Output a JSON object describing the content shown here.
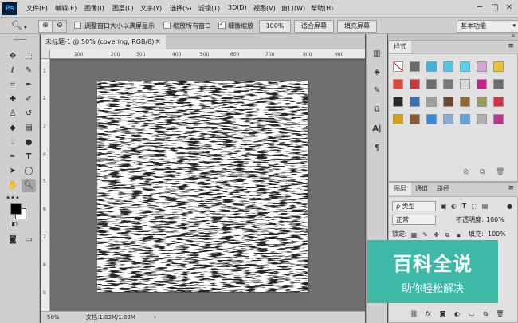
{
  "app": {
    "logo": "Ps"
  },
  "menu": [
    "文件(F)",
    "编辑(E)",
    "图像(I)",
    "图层(L)",
    "文字(Y)",
    "选择(S)",
    "滤镜(T)",
    "3D(D)",
    "视图(V)",
    "窗口(W)",
    "帮助(H)"
  ],
  "window_controls": {
    "minimize": "─",
    "maximize": "□",
    "close": "✕"
  },
  "options": {
    "zoom_icon": "magnifier",
    "resize_windows": "调整窗口大小以满屏显示",
    "zoom_all": "缩放所有窗口",
    "scrubby_zoom": "细微缩放",
    "btn_100": "100%",
    "btn_fit": "适合屏幕",
    "btn_fill": "填充屏幕",
    "workspace": "基本功能"
  },
  "document": {
    "tab_title": "未标题-1 @ 50% (covering, RGB/8) *",
    "close": "×",
    "zoom": "50%",
    "doc_info": "文档:1.83M/1.83M",
    "ruler_top": [
      "100",
      "200",
      "300",
      "400",
      "500",
      "600",
      "700",
      "800",
      "900"
    ],
    "ruler_left": [
      "1",
      "2",
      "3",
      "4",
      "5",
      "6",
      "7",
      "8",
      "9"
    ]
  },
  "styles_panel": {
    "tab": "样式",
    "menu_icon": "≡",
    "collapse": "»",
    "swatch_colors": [
      [
        "#ffffff",
        "#6b6b6b",
        "#3fb6d9",
        "#4fc7e6",
        "#5ad3ea",
        "#d6a4d0",
        "#e8c23a"
      ],
      [
        "#d94a3b",
        "#c93838",
        "#6d6d6d",
        "#7a7a7a",
        "#d8d8d8",
        "#c8208e",
        "#6b6b6b"
      ],
      [
        "#2a2a2a",
        "#3a6fb0",
        "#a0a0a0",
        "#6a4a2a",
        "#8a6a3a",
        "#9a9a5a",
        "#c9354a"
      ],
      [
        "#d4a017",
        "#8a5a2a",
        "#3a8ad0",
        "#8aaad8",
        "#6aa0d8",
        "#b0b0b0",
        "#b03a8a"
      ]
    ]
  },
  "layers_panel": {
    "tabs": [
      "图层",
      "通道",
      "路径"
    ],
    "filter_label": "ρ 类型",
    "blend_mode": "正常",
    "opacity_label": "不透明度:",
    "opacity_value": "100%",
    "lock_label": "锁定:",
    "fill_label": "填充:",
    "fill_value": "100%"
  },
  "watermark": {
    "title": "百科全说",
    "subtitle": "助你轻松解决"
  }
}
